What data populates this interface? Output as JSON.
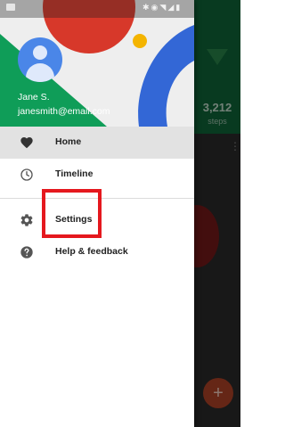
{
  "status_bar": {
    "icons": [
      "notification-icon",
      "bluetooth-icon",
      "alarm-icon",
      "wifi-icon",
      "signal-icon",
      "battery-icon"
    ]
  },
  "account": {
    "name": "Jane S.",
    "email": "janesmith@email.com"
  },
  "menu": {
    "primary": [
      {
        "label": "Home",
        "icon": "heart-icon",
        "selected": true
      },
      {
        "label": "Timeline",
        "icon": "clock-icon",
        "selected": false
      }
    ],
    "secondary": [
      {
        "label": "Settings",
        "icon": "gear-icon",
        "selected": false
      },
      {
        "label": "Help & feedback",
        "icon": "help-icon",
        "selected": false
      }
    ]
  },
  "background_app": {
    "steps_count": "3,212",
    "steps_label": "steps",
    "fab_label": "+"
  },
  "annotation": {
    "highlight_target": "settings",
    "highlight_color": "#e5181e"
  },
  "colors": {
    "header_red": "#d7382a",
    "header_green": "#0f9d58",
    "header_blue": "#3367d6",
    "header_yellow": "#f4b400",
    "avatar_blue": "#4a86e8",
    "selected_row": "#e2e2e2"
  }
}
